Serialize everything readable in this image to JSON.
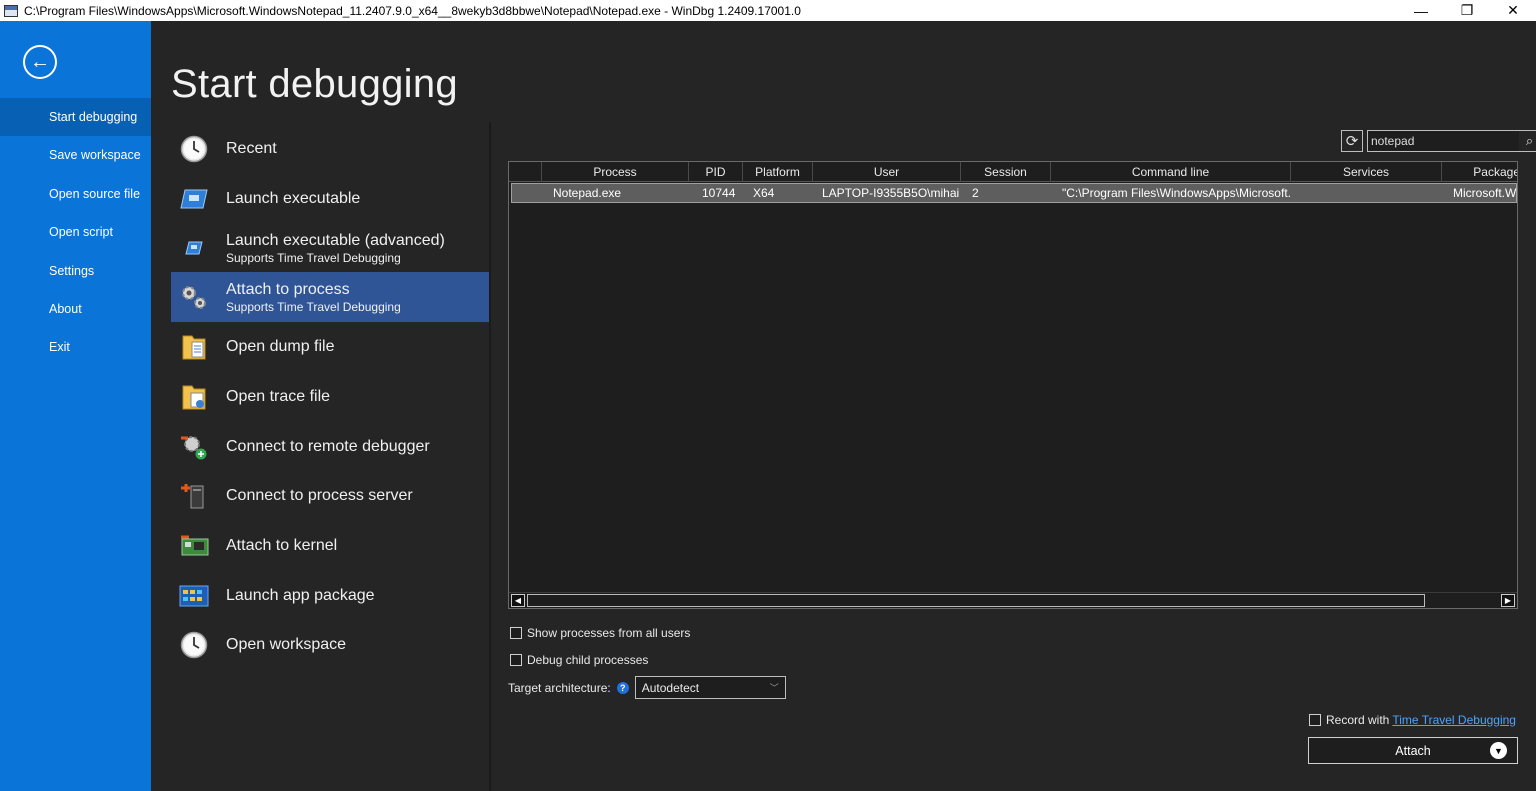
{
  "window": {
    "title": "C:\\Program Files\\WindowsApps\\Microsoft.WindowsNotepad_11.2407.9.0_x64__8wekyb3d8bbwe\\Notepad\\Notepad.exe - WinDbg 1.2409.17001.0",
    "minimize": "—",
    "restore": "❐",
    "close": "✕"
  },
  "sidebar": {
    "back_icon": "←",
    "items": [
      {
        "label": "Start debugging"
      },
      {
        "label": "Save workspace"
      },
      {
        "label": "Open source file"
      },
      {
        "label": "Open script"
      },
      {
        "label": "Settings"
      },
      {
        "label": "About"
      },
      {
        "label": "Exit"
      }
    ]
  },
  "page_title": "Start debugging",
  "menu": [
    {
      "label": "Recent",
      "sub": "",
      "icon": "clock-icon"
    },
    {
      "label": "Launch executable",
      "sub": "",
      "icon": "executable-icon"
    },
    {
      "label": "Launch executable (advanced)",
      "sub": "Supports Time Travel Debugging",
      "icon": "executable-advanced-icon"
    },
    {
      "label": "Attach to process",
      "sub": "Supports Time Travel Debugging",
      "icon": "gears-icon"
    },
    {
      "label": "Open dump file",
      "sub": "",
      "icon": "dump-file-icon"
    },
    {
      "label": "Open trace file",
      "sub": "",
      "icon": "trace-file-icon"
    },
    {
      "label": "Connect to remote debugger",
      "sub": "",
      "icon": "remote-debugger-icon"
    },
    {
      "label": "Connect to process server",
      "sub": "",
      "icon": "process-server-icon"
    },
    {
      "label": "Attach to kernel",
      "sub": "",
      "icon": "kernel-icon"
    },
    {
      "label": "Launch app package",
      "sub": "",
      "icon": "app-package-icon"
    },
    {
      "label": "Open workspace",
      "sub": "",
      "icon": "clock-icon"
    }
  ],
  "search": {
    "value": "notepad",
    "refresh_icon": "⟳",
    "search_icon": "⌕"
  },
  "table": {
    "columns": [
      "Process",
      "PID",
      "Platform",
      "User",
      "Session",
      "Command line",
      "Services",
      "Package"
    ],
    "rows": [
      {
        "process": "Notepad.exe",
        "pid": "10744",
        "platform": "X64",
        "user": "LAPTOP-I9355B5O\\mihai",
        "session": "2",
        "command_line": "\"C:\\Program Files\\WindowsApps\\Microsoft.",
        "services": "",
        "package": "Microsoft.Wi"
      }
    ]
  },
  "options": {
    "show_all_users": "Show processes from all users",
    "debug_child": "Debug child processes",
    "target_arch_label": "Target architecture:",
    "target_arch_value": "Autodetect",
    "help_icon": "?"
  },
  "ttd": {
    "prefix": "Record with",
    "link": "Time Travel Debugging"
  },
  "attach_button": "Attach"
}
